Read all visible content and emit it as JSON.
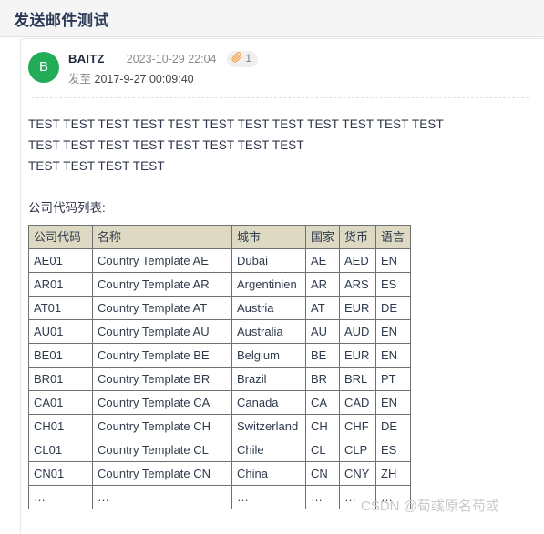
{
  "header": {
    "title": "发送邮件测试"
  },
  "mail": {
    "avatar_initial": "B",
    "avatar_color": "#23ac58",
    "sender": "BAITZ",
    "date": "2023-10-29 22:04",
    "attachment": {
      "icon": "paperclip-icon",
      "count": "1",
      "icon_color": "#f0a44a"
    },
    "received_label": "发至",
    "received_time": "2017-9-27 00:09:40",
    "body_lines": [
      "TEST TEST TEST TEST TEST TEST TEST TEST TEST TEST TEST TEST",
      "TEST TEST TEST TEST TEST TEST TEST TEST",
      "TEST TEST TEST TEST"
    ],
    "list_label": "公司代码列表:"
  },
  "table": {
    "headers": [
      "公司代码",
      "名称",
      "城市",
      "国家",
      "货币",
      "语言"
    ],
    "header_bg": "#ddd9c3",
    "rows": [
      [
        "AE01",
        "Country Template AE",
        "Dubai",
        "AE",
        "AED",
        "EN"
      ],
      [
        "AR01",
        "Country Template AR",
        "Argentinien",
        "AR",
        "ARS",
        "ES"
      ],
      [
        "AT01",
        "Country Template AT",
        "Austria",
        "AT",
        "EUR",
        "DE"
      ],
      [
        "AU01",
        "Country Template AU",
        "Australia",
        "AU",
        "AUD",
        "EN"
      ],
      [
        "BE01",
        "Country Template BE",
        "Belgium",
        "BE",
        "EUR",
        "EN"
      ],
      [
        "BR01",
        "Country Template BR",
        "Brazil",
        "BR",
        "BRL",
        "PT"
      ],
      [
        "CA01",
        "Country Template CA",
        "Canada",
        "CA",
        "CAD",
        "EN"
      ],
      [
        "CH01",
        "Country Template CH",
        "Switzerland",
        "CH",
        "CHF",
        "DE"
      ],
      [
        "CL01",
        "Country Template CL",
        "Chile",
        "CL",
        "CLP",
        "ES"
      ],
      [
        "CN01",
        "Country Template CN",
        "China",
        "CN",
        "CNY",
        "ZH"
      ],
      [
        "…",
        "…",
        "…",
        "…",
        "…",
        "…"
      ]
    ]
  },
  "watermark": {
    "text": "CSDN @荀彧原名苟或"
  }
}
